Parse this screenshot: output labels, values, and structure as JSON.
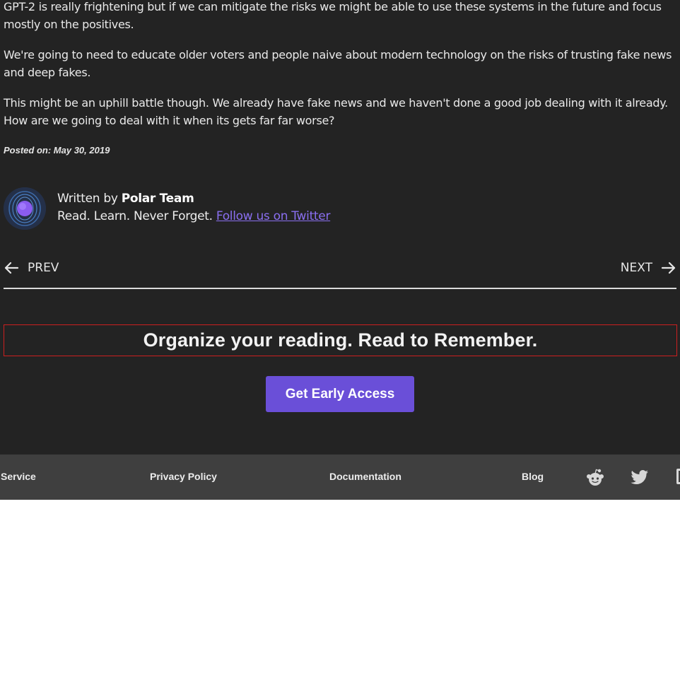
{
  "article": {
    "paragraphs": [
      "GPT-2 is really frightening but if we can mitigate the risks we might be able to use these systems in the future and focus mostly on the positives.",
      "We're going to need to educate older voters and people naive about modern technology on the risks of trusting fake news and deep fakes.",
      "This might be an uphill battle though. We already have fake news and we haven't done a good job dealing with it already. How are we going to deal with it when its gets far far worse?"
    ],
    "posted_label": "Posted on:",
    "posted_date": "May 30, 2019"
  },
  "author": {
    "written_by": "Written by",
    "name": "Polar Team",
    "tagline": "Read. Learn. Never Forget.",
    "twitter_link": "Follow us on Twitter",
    "avatar_icon": "polar-logo-icon"
  },
  "nav": {
    "prev_label": "PREV",
    "next_label": "NEXT",
    "prev_icon": "arrow-left-icon",
    "next_icon": "arrow-right-icon"
  },
  "cta": {
    "heading": "Organize your reading. Read to Remember.",
    "button_label": "Get Early Access",
    "button_color": "#6a4fd8"
  },
  "footer": {
    "links": [
      "Service",
      "Privacy Policy",
      "Documentation",
      "Blog"
    ],
    "icons": [
      "reddit-icon",
      "twitter-icon",
      "partial-icon"
    ]
  },
  "colors": {
    "background": "#232323",
    "footer_background": "#3f3f3f",
    "link": "#8a6ff0",
    "cta_border": "#cc1f1f"
  }
}
